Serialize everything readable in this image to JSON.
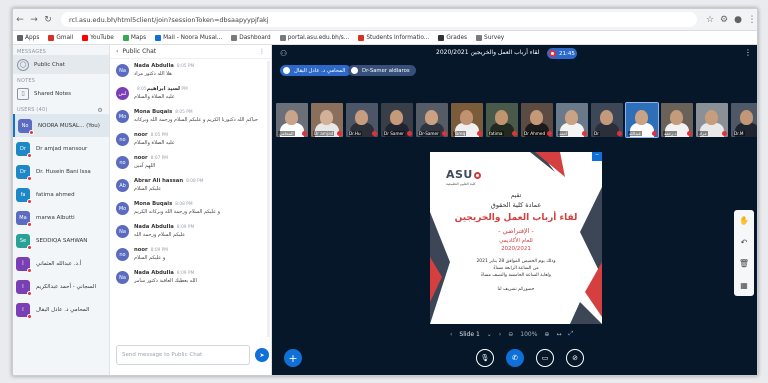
{
  "browser": {
    "address": "rcl.asu.edu.bh/html5client/join?sessionToken=dbsaapyypjfakj",
    "nav": [
      "←",
      "→",
      "↻"
    ]
  },
  "bookmarks": [
    {
      "label": "Apps",
      "color": "#5f6368"
    },
    {
      "label": "Gmail",
      "color": "#d93025"
    },
    {
      "label": "YouTube",
      "color": "#ff0000"
    },
    {
      "label": "Maps",
      "color": "#34a853"
    },
    {
      "label": "Mail - Noora Musal...",
      "color": "#0f70d7"
    },
    {
      "label": "Dashboard",
      "color": "#7a7a7a"
    },
    {
      "label": "portal.asu.edu.bh/s...",
      "color": "#7a7a7a"
    },
    {
      "label": "Students Informatio...",
      "color": "#d93025"
    },
    {
      "label": "Grades",
      "color": "#333333"
    },
    {
      "label": "Survey",
      "color": "#7a7a7a"
    }
  ],
  "sidebar": {
    "messages_label": "MESSAGES",
    "public_chat": "Public Chat",
    "notes_label": "NOTES",
    "shared_notes": "Shared Notes",
    "users_label": "USERS (40)",
    "users": [
      {
        "initials": "No",
        "name": "NOORA MUSAL... (You)",
        "color": "#5b6bbf",
        "active": true
      },
      {
        "initials": "Dr",
        "name": "Dr amjad mansour",
        "color": "#1e88c7",
        "active": false
      },
      {
        "initials": "Dr",
        "name": "Dr. Husein Bani Issa",
        "color": "#1e88c7",
        "active": false
      },
      {
        "initials": "fa",
        "name": "fatima ahmed",
        "color": "#1e88c7",
        "active": false
      },
      {
        "initials": "Ma",
        "name": "marwa Albutti",
        "color": "#5b6bbf",
        "active": false
      },
      {
        "initials": "Se",
        "name": "SEDDIQA SAHWAN",
        "color": "#2aa198",
        "active": false
      },
      {
        "initials": "أ",
        "name": "أ.د. عبدالله العثماني",
        "color": "#7b3fb5",
        "active": false
      },
      {
        "initials": "ا",
        "name": "السجاني - أحمد عبدالكريم",
        "color": "#7b3fb5",
        "active": false
      },
      {
        "initials": "ا",
        "name": "المحامي د. عادل البقال",
        "color": "#7b3fb5",
        "active": false
      }
    ]
  },
  "chat": {
    "title": "Public Chat",
    "input_placeholder": "Send message to Public Chat",
    "messages": [
      {
        "initials": "Na",
        "color": "#5b6bbf",
        "name": "Nada Abdulla",
        "time": "8:05 PM",
        "text": "هلا الله دكتور مراد"
      },
      {
        "initials": "لس",
        "color": "#7b3fb5",
        "name": "لسيد ابراهيم",
        "time": "8:05 PM",
        "text": "عليه الصلاة والسلام"
      },
      {
        "initials": "Mo",
        "color": "#5b6bbf",
        "name": "Mona Buqais",
        "time": "8:05 PM",
        "text": "حياكم الله دكتورنا الكريم و عليكم السلام ورحمة الله وبركاته"
      },
      {
        "initials": "no",
        "color": "#5b6bbf",
        "name": "noor",
        "time": "8:05 PM",
        "text": "عليه الصلاة والسلام"
      },
      {
        "initials": "no",
        "color": "#5b6bbf",
        "name": "noor",
        "time": "8:07 PM",
        "text": "اللهم آمين"
      },
      {
        "initials": "Ab",
        "color": "#5b6bbf",
        "name": "Abrar Ali hassan",
        "time": "8:08 PM",
        "text": "عليكم السلام"
      },
      {
        "initials": "Mo",
        "color": "#5b6bbf",
        "name": "Mona Buqais",
        "time": "8:08 PM",
        "text": "و عليكم السلام ورحمة الله وبركاته الكريم"
      },
      {
        "initials": "Na",
        "color": "#5b6bbf",
        "name": "Nada Abdulla",
        "time": "8:09 PM",
        "text": "عليكم السلام ورحمة الله"
      },
      {
        "initials": "no",
        "color": "#5b6bbf",
        "name": "noor",
        "time": "8:09 PM",
        "text": "و عليكم السلام"
      },
      {
        "initials": "Na",
        "color": "#5b6bbf",
        "name": "Nada Abdulla",
        "time": "8:09 PM",
        "text": "الله يعطيك العافية دكتور سامر"
      }
    ]
  },
  "video": {
    "meeting_title": "لقاء أرباب العمل والخريجين 2020/2021",
    "timer": "21:45",
    "talkers": [
      {
        "name": "المحامي د. عادل البقال",
        "color": "#2d69c9"
      },
      {
        "name": "Dr-Samer aldiaros",
        "color": "#37507a"
      }
    ],
    "thumbnails": [
      {
        "caption": "المحامي",
        "bg": "#6b6f78",
        "skin": "#c9a48a",
        "cloth": "#ffffff",
        "highlight": false
      },
      {
        "caption": "Dr amjad",
        "bg": "#8a6f5d",
        "skin": "#d3b197",
        "cloth": "#e8e8e8",
        "highlight": false
      },
      {
        "caption": "Dr.Hu",
        "bg": "#4c5667",
        "skin": "#c79d7f",
        "cloth": "#2b2f38",
        "highlight": false
      },
      {
        "caption": "Dr Samer",
        "bg": "#3a3f47",
        "skin": "#c49a7a",
        "cloth": "#1f2430",
        "highlight": false
      },
      {
        "caption": "Dr-Samer",
        "bg": "#565c66",
        "skin": "#caa283",
        "cloth": "#2e3440",
        "highlight": false
      },
      {
        "caption": "Tareq",
        "bg": "#7a5b3a",
        "skin": "#c09272",
        "cloth": "#f0f0f0",
        "highlight": false
      },
      {
        "caption": "fatima",
        "bg": "#4a5a4a",
        "skin": "#bf946f",
        "cloth": "#202a20",
        "highlight": false
      },
      {
        "caption": "Dr Ahmed",
        "bg": "#5b4b43",
        "skin": "#c59878",
        "cloth": "#1b1b1b",
        "highlight": false
      },
      {
        "caption": "أحمد",
        "bg": "#6b7a8a",
        "skin": "#caa384",
        "cloth": "#f4f4f4",
        "highlight": false
      },
      {
        "caption": "Dr",
        "bg": "#3d4756",
        "skin": "#c39a7b",
        "cloth": "#2a2f3a",
        "highlight": false
      },
      {
        "caption": "عبدالله",
        "bg": "#2f6fb8",
        "skin": "#caa384",
        "cloth": "#ffffff",
        "highlight": true
      },
      {
        "caption": "د.رحمة",
        "bg": "#6a6258",
        "skin": "#c49c7c",
        "cloth": "#f3f3f3",
        "highlight": false
      },
      {
        "caption": "مراد",
        "bg": "#8b8f96",
        "skin": "#c69e7e",
        "cloth": "#e9e9e9",
        "highlight": false
      },
      {
        "caption": "Dr.M",
        "bg": "#4f5866",
        "skin": "#c19777",
        "cloth": "#1e2430",
        "highlight": false
      }
    ]
  },
  "slide": {
    "logo": "ASU",
    "logo_sub": "كلية العلوم التطبيقية",
    "lines": [
      "تقيم",
      "عمادة كلية الحقوق",
      "لقاء أرباب العمل والخريجين",
      "- الإفتراضي -",
      "للعام الأكاديمي",
      "2020/2021",
      "وذلك يوم الخميس الموافق 28 يناير 2021",
      "من الساعة الرابعة مساءً",
      "ولغاية الساعة الخامسة والنصف مساءً",
      "حضوركم تشريف لنا"
    ]
  },
  "slide_controls": {
    "label": "Slide 1",
    "zoom": "100%"
  }
}
